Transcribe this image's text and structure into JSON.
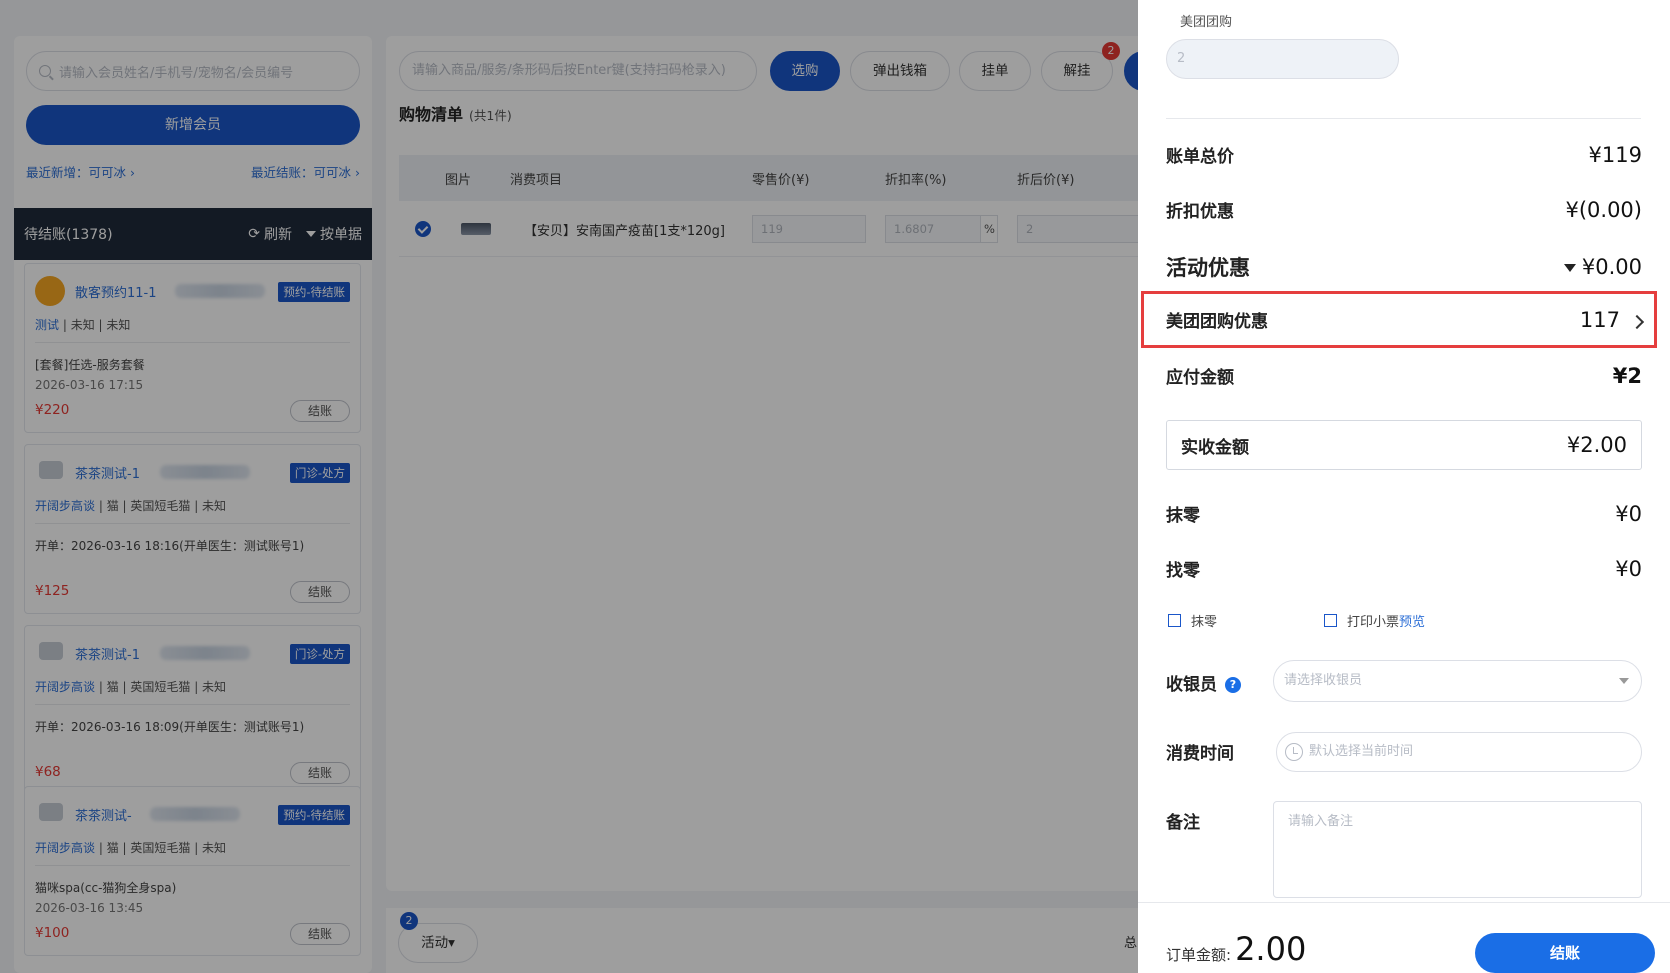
{
  "left": {
    "member_search_placeholder": "请输入会员姓名/手机号/宠物名/会员编号",
    "new_member": "新增会员",
    "recent_added": "最近新增：可可冰 ›",
    "recent_settled": "最近结账：可可冰 ›",
    "pending_title": "待结账(1378)",
    "refresh": "刷新",
    "by_bill": "按单据",
    "cards": [
      {
        "name": "散客预约11-1",
        "tag": "预约-待结账",
        "meta_link": "测试",
        "meta_rest": "| 未知 | 未知",
        "line1": "[套餐]任选-服务套餐",
        "line2": "2026-03-16 17:15",
        "price": "¥220",
        "btn": "结账"
      },
      {
        "name": "茶茶测试-1",
        "tag": "门诊-处方",
        "meta_link": "开阔步高谈",
        "meta_rest": "| 猫 | 英国短毛猫 | 未知",
        "line1": "开单：2026-03-16 18:16(开单医生：测试账号1)",
        "line2": "",
        "price": "¥125",
        "btn": "结账"
      },
      {
        "name": "茶茶测试-1",
        "tag": "门诊-处方",
        "meta_link": "开阔步高谈",
        "meta_rest": "| 猫 | 英国短毛猫 | 未知",
        "line1": "开单：2026-03-16 18:09(开单医生：测试账号1)",
        "line2": "",
        "price": "¥68",
        "btn": "结账"
      },
      {
        "name": "茶茶测试-",
        "tag": "预约-待结账",
        "meta_link": "开阔步高谈",
        "meta_rest": "| 猫 | 英国短毛猫 | 未知",
        "line1": "猫咪spa(cc-猫狗全身spa)",
        "line2": "2026-03-16 13:45",
        "price": "¥100",
        "btn": "结账"
      }
    ]
  },
  "center": {
    "product_search_placeholder": "请输入商品/服务/条形码后按Enter键(支持扫码枪录入)",
    "buttons": {
      "select": "选购",
      "cash_drawer": "弹出钱箱",
      "hang": "挂单",
      "unhang": "解挂"
    },
    "unhang_badge": "2",
    "cart_title": "购物清单",
    "cart_count": "(共1件)",
    "columns": [
      "图片",
      "消费项目",
      "零售价(¥)",
      "折扣率(%)",
      "折后价(¥)"
    ],
    "row": {
      "name": "【安贝】安南国产疫苗[1支*120g]",
      "retail": "119",
      "discount": "1.6807",
      "percent": "%",
      "after": "2"
    },
    "activity": "活动▾",
    "activity_badge": "2",
    "total_fragment": "总"
  },
  "drawer": {
    "meituan_label": "美团团购",
    "meituan_value": "2",
    "bill_total_label": "账单总价",
    "bill_total": "¥119",
    "discount_label": "折扣优惠",
    "discount": "¥(0.00)",
    "activity_label": "活动优惠",
    "activity": "¥0.00",
    "meituan_discount_label": "美团团购优惠",
    "meituan_discount": "117",
    "payable_label": "应付金额",
    "payable": "¥2",
    "received_label": "实收金额",
    "received": "¥2.00",
    "rounding_label": "抹零",
    "rounding": "¥0",
    "change_label": "找零",
    "change": "¥0",
    "cb_rounding": "抹零",
    "cb_print": "打印小票",
    "cb_preview": "预览",
    "cashier_label": "收银员",
    "cashier_placeholder": "请选择收银员",
    "time_label": "消费时间",
    "time_placeholder": "默认选择当前时间",
    "remark_label": "备注",
    "remark_placeholder": "请输入备注",
    "order_amount_label": "订单金额:",
    "order_amount": "2.00",
    "checkout": "结账"
  }
}
